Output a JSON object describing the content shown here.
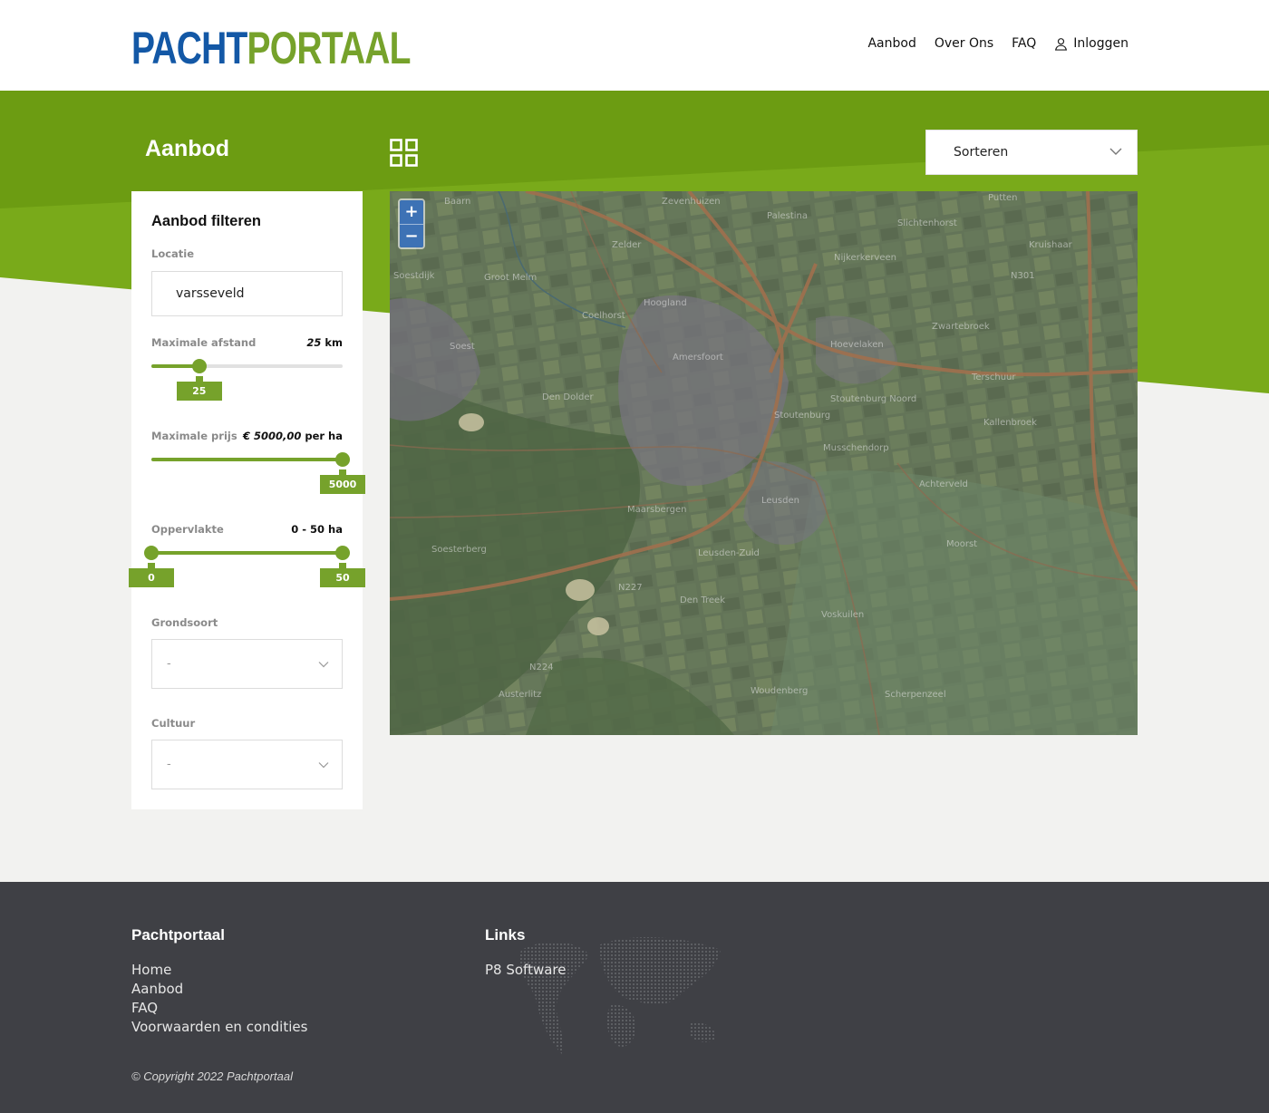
{
  "brand": {
    "logo_part1": "PACHT",
    "logo_part2": "PORTAAL",
    "primary": "#1358a6",
    "accent": "#76a22b"
  },
  "nav": {
    "items": [
      {
        "label": "Aanbod"
      },
      {
        "label": "Over Ons"
      },
      {
        "label": "FAQ"
      }
    ],
    "login_label": "Inloggen",
    "login_icon": "user-icon"
  },
  "page": {
    "title": "Aanbod",
    "view_toggle_icon": "grid-icon"
  },
  "sort": {
    "label": "Sorteren"
  },
  "filter": {
    "title": "Aanbod filteren",
    "location": {
      "label": "Locatie",
      "value": "varsseveld"
    },
    "distance": {
      "label": "Maximale afstand",
      "value_num": "25",
      "unit": "km",
      "tooltip": "25",
      "fraction": 0.25
    },
    "price": {
      "label": "Maximale prijs",
      "value_num": "€ 5000,00",
      "unit": "per ha",
      "tooltip": "5000",
      "fraction": 1.0
    },
    "area": {
      "label": "Oppervlakte",
      "value": "0 - 50 ha",
      "min_tooltip": "0",
      "max_tooltip": "50",
      "min_fraction": 0.0,
      "max_fraction": 1.0
    },
    "soil": {
      "label": "Grondsoort",
      "value": "-"
    },
    "crop": {
      "label": "Cultuur",
      "value": "-"
    }
  },
  "map": {
    "zoom_in": "+",
    "zoom_out": "−",
    "places": [
      "Baarn",
      "Zevenhuizen",
      "Palestina",
      "Slichtenhorst",
      "Putten",
      "Kruishaar",
      "Zelder",
      "Nijkerkerveen",
      "N301",
      "Soestdijk",
      "Groot Melm",
      "Hoogland",
      "Coelhorst",
      "Zwartebroek",
      "Soest",
      "Hoevelaken",
      "Amersfoort",
      "Terschuur",
      "Den Dolder",
      "Stoutenburg Noord",
      "Stoutenburg",
      "Kallenbroek",
      "Musschendorp",
      "Achterveld",
      "Leusden",
      "Maarsbergen",
      "Soesterberg",
      "Leusden-Zuid",
      "Moorst",
      "Den Treek",
      "N227",
      "Voskuilen",
      "N224",
      "Austerlitz",
      "Woudenberg",
      "Scherpenzeel"
    ]
  },
  "footer": {
    "col1_title": "Pachtportaal",
    "col1_links": [
      "Home",
      "Aanbod",
      "FAQ",
      "Voorwaarden en condities"
    ],
    "col2_title": "Links",
    "col2_links": [
      "P8 Software"
    ],
    "copyright": "© Copyright 2022 Pachtportaal"
  }
}
